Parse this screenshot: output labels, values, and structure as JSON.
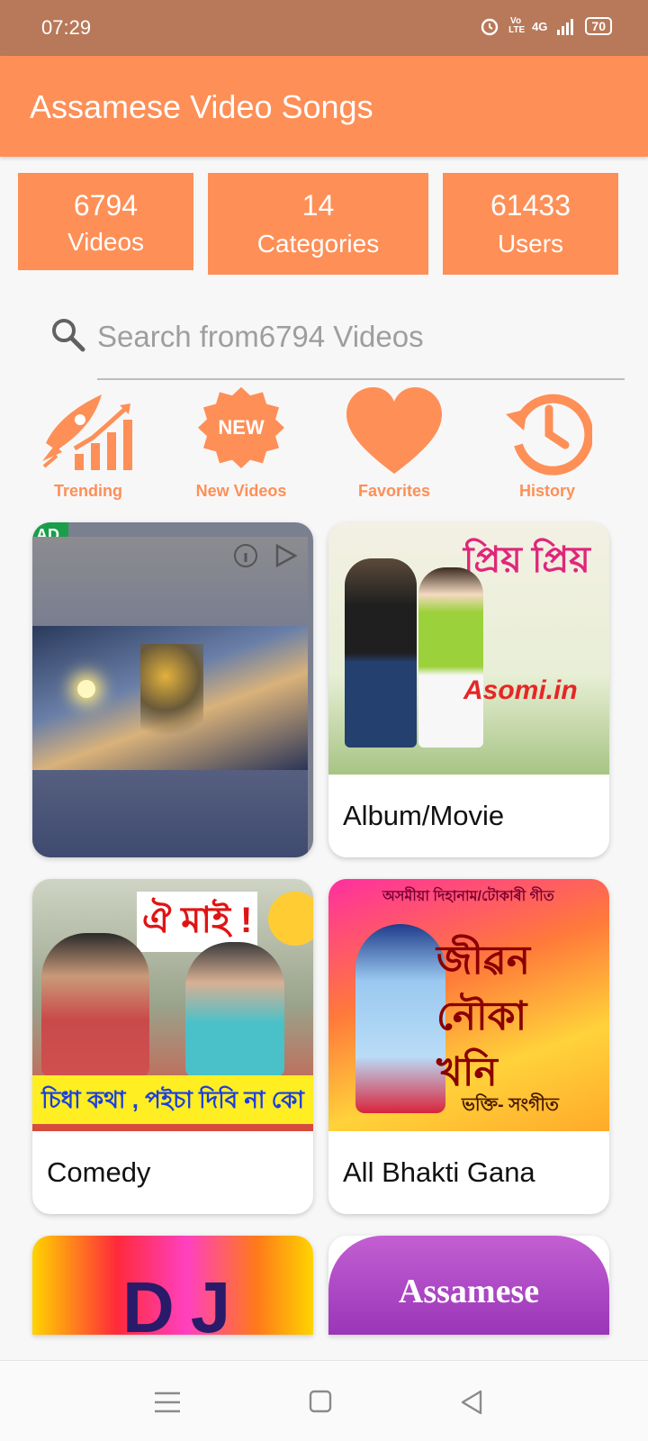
{
  "status_bar": {
    "time": "07:29",
    "network": "4G",
    "volte": "Vo LTE",
    "battery": "70"
  },
  "app_bar": {
    "title": "Assamese Video Songs"
  },
  "stats": [
    {
      "value": "6794",
      "label": "Videos"
    },
    {
      "value": "14",
      "label": "Categories"
    },
    {
      "value": "61433",
      "label": "Users"
    }
  ],
  "search": {
    "placeholder": "Search from6794 Videos"
  },
  "quick_actions": [
    {
      "label": "Trending",
      "icon": "trending-rocket-icon"
    },
    {
      "label": "New Videos",
      "icon": "new-badge-icon",
      "badge": "NEW"
    },
    {
      "label": "Favorites",
      "icon": "heart-icon"
    },
    {
      "label": "History",
      "icon": "history-clock-icon"
    }
  ],
  "ad": {
    "badge": "AD"
  },
  "categories": [
    {
      "label": "Album/Movie",
      "thumb_text": "প্ৰিয় প্ৰিয়",
      "watermark": "Asomi.in"
    },
    {
      "label": "Comedy",
      "thumb_text": "ঐ মাই !",
      "thumb_subtext": "চিধা কথা , পইচা দিবি না কো"
    },
    {
      "label": "All Bhakti Gana",
      "thumb_text": "জীৱন নৌকা খনি",
      "thumb_subtext": "ভক্তি- সংগীত",
      "thumb_header": "অসমীয়া দিহানাম/টোকাৰী গীত"
    },
    {
      "label": "",
      "thumb_text": "DJ"
    },
    {
      "label": "",
      "thumb_text": "Assamese"
    }
  ],
  "colors": {
    "accent": "#fe8f57",
    "status_bar": "#b8795a",
    "background": "#f7f7f7"
  },
  "nav_bar": {
    "icons": [
      "menu-icon",
      "home-square-icon",
      "back-triangle-icon"
    ]
  }
}
